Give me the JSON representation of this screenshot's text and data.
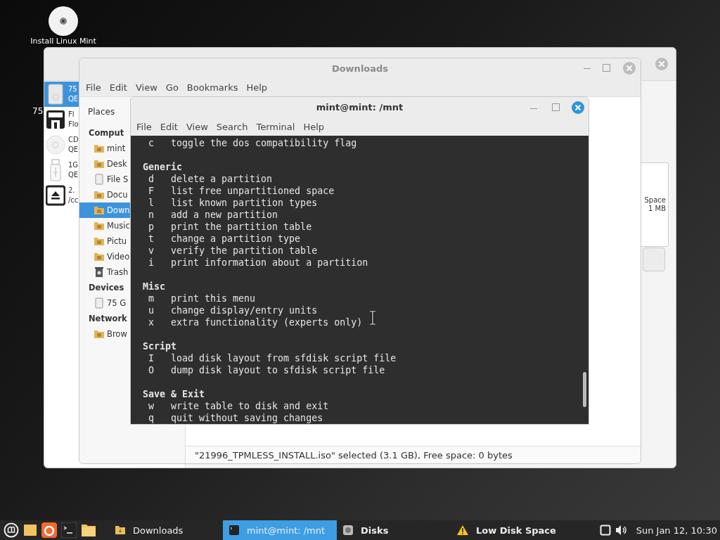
{
  "desktop": {
    "icons": [
      {
        "kind": "disc",
        "label": "Install Linux Mint"
      },
      {
        "kind": "label",
        "label": "75"
      }
    ]
  },
  "disks_window": {
    "devices": [
      {
        "kind": "disk",
        "line1": "75",
        "line2": "QE",
        "selected": true
      },
      {
        "kind": "floppy",
        "line1": "Fl",
        "line2": "Flo",
        "selected": false
      },
      {
        "kind": "optical",
        "line1": "CD",
        "line2": "QE",
        "selected": false
      },
      {
        "kind": "usb",
        "line1": "1G",
        "line2": "QE",
        "selected": false
      },
      {
        "kind": "loop",
        "line1": "2.",
        "line2": "/cc",
        "selected": false
      }
    ],
    "volume_info": {
      "label": "Space",
      "value": "1 MB"
    }
  },
  "downloads_window": {
    "title": "Downloads",
    "menu": [
      "File",
      "Edit",
      "View",
      "Go",
      "Bookmarks",
      "Help"
    ],
    "places_label": "Places",
    "sidebar": [
      {
        "kind": "header",
        "label": "Comput"
      },
      {
        "kind": "home",
        "label": "mint",
        "selected": false
      },
      {
        "kind": "folder",
        "label": "Desk",
        "selected": false
      },
      {
        "kind": "drive",
        "label": "File S",
        "selected": false
      },
      {
        "kind": "folder",
        "label": "Docu",
        "selected": false
      },
      {
        "kind": "folder",
        "label": "Down",
        "selected": true
      },
      {
        "kind": "folder",
        "label": "Music",
        "selected": false
      },
      {
        "kind": "folder",
        "label": "Pictu",
        "selected": false
      },
      {
        "kind": "folder",
        "label": "Video",
        "selected": false
      },
      {
        "kind": "trash",
        "label": "Trash",
        "selected": false
      },
      {
        "kind": "header",
        "label": "Devices"
      },
      {
        "kind": "drive",
        "label": "75 G",
        "selected": false
      },
      {
        "kind": "header",
        "label": "Network"
      },
      {
        "kind": "folder",
        "label": "Brow",
        "selected": false
      }
    ],
    "status_bar": "\"21996_TPMLESS_INSTALL.iso\" selected (3.1 GB), Free space: 0 bytes"
  },
  "terminal": {
    "title": "mint@mint: /mnt",
    "menu": [
      "File",
      "Edit",
      "View",
      "Search",
      "Terminal",
      "Help"
    ],
    "lines": [
      {
        "kind": "command",
        "key": "c",
        "text": "toggle the dos compatibility flag"
      },
      {
        "kind": "heading",
        "text": "Generic"
      },
      {
        "kind": "command",
        "key": "d",
        "text": "delete a partition"
      },
      {
        "kind": "command",
        "key": "F",
        "text": "list free unpartitioned space"
      },
      {
        "kind": "command",
        "key": "l",
        "text": "list known partition types"
      },
      {
        "kind": "command",
        "key": "n",
        "text": "add a new partition"
      },
      {
        "kind": "command",
        "key": "p",
        "text": "print the partition table"
      },
      {
        "kind": "command",
        "key": "t",
        "text": "change a partition type"
      },
      {
        "kind": "command",
        "key": "v",
        "text": "verify the partition table"
      },
      {
        "kind": "command",
        "key": "i",
        "text": "print information about a partition"
      },
      {
        "kind": "heading",
        "text": "Misc"
      },
      {
        "kind": "command",
        "key": "m",
        "text": "print this menu"
      },
      {
        "kind": "command",
        "key": "u",
        "text": "change display/entry units"
      },
      {
        "kind": "command",
        "key": "x",
        "text": "extra functionality (experts only)"
      },
      {
        "kind": "heading",
        "text": "Script"
      },
      {
        "kind": "command",
        "key": "I",
        "text": "load disk layout from sfdisk script file"
      },
      {
        "kind": "command",
        "key": "O",
        "text": "dump disk layout to sfdisk script file"
      },
      {
        "kind": "heading",
        "text": "Save & Exit"
      },
      {
        "kind": "command",
        "key": "w",
        "text": "write table to disk and exit"
      },
      {
        "kind": "command",
        "key": "q",
        "text": "quit without saving changes"
      }
    ]
  },
  "taskbar": {
    "launchers": [
      {
        "kind": "menu"
      },
      {
        "kind": "folder"
      },
      {
        "kind": "browser"
      },
      {
        "kind": "terminal"
      },
      {
        "kind": "files"
      }
    ],
    "windows": [
      {
        "kind": "folder",
        "label": "Downloads",
        "selected": false
      },
      {
        "kind": "terminal",
        "label": "mint@mint: /mnt",
        "selected": true
      },
      {
        "kind": "disks",
        "label": "Disks",
        "selected": false
      },
      {
        "kind": "warning",
        "label": "Low Disk Space",
        "selected": false
      }
    ],
    "clock": "Sun Jan 12, 10:30"
  }
}
